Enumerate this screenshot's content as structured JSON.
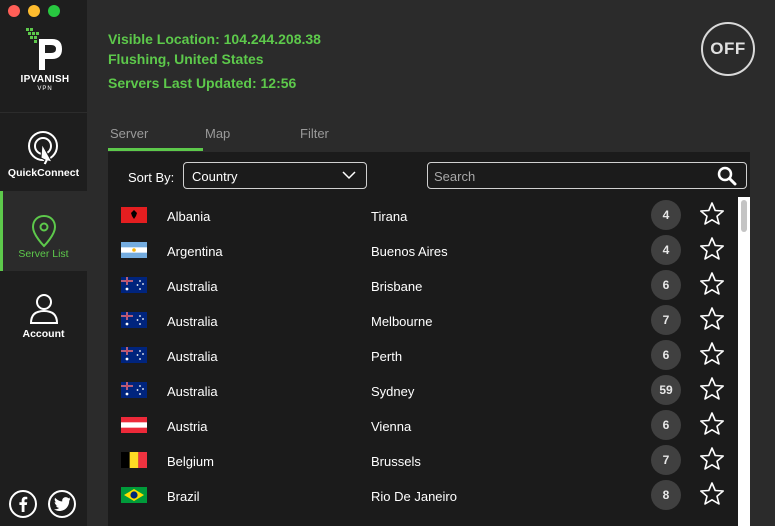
{
  "window": {
    "traffic_lights": {
      "close": "#ff5f57",
      "minimize": "#febc2e",
      "maximize": "#28c840"
    }
  },
  "brand": {
    "name": "IPVANISH",
    "sub": "VPN",
    "accent": "#5dc94b"
  },
  "sidebar": {
    "items": [
      {
        "label": "QuickConnect",
        "icon": "quickconnect-icon"
      },
      {
        "label": "Server List",
        "icon": "map-pin-icon"
      },
      {
        "label": "Account",
        "icon": "user-icon"
      }
    ],
    "social": [
      {
        "icon": "facebook-icon"
      },
      {
        "icon": "twitter-icon"
      }
    ]
  },
  "status": {
    "visible_location": "Visible Location: 104.244.208.38",
    "city": "Flushing, United States",
    "servers_updated": "Servers Last Updated: 12:56",
    "toggle_label": "OFF"
  },
  "tabs": [
    {
      "label": "Server"
    },
    {
      "label": "Map"
    },
    {
      "label": "Filter"
    }
  ],
  "controls": {
    "sort_label": "Sort By:",
    "sort_value": "Country",
    "search_placeholder": "Search"
  },
  "servers": [
    {
      "flag": "albania",
      "country": "Albania",
      "city": "Tirana",
      "count": "4"
    },
    {
      "flag": "argentina",
      "country": "Argentina",
      "city": "Buenos Aires",
      "count": "4"
    },
    {
      "flag": "australia",
      "country": "Australia",
      "city": "Brisbane",
      "count": "6"
    },
    {
      "flag": "australia",
      "country": "Australia",
      "city": "Melbourne",
      "count": "7"
    },
    {
      "flag": "australia",
      "country": "Australia",
      "city": "Perth",
      "count": "6"
    },
    {
      "flag": "australia",
      "country": "Australia",
      "city": "Sydney",
      "count": "59"
    },
    {
      "flag": "austria",
      "country": "Austria",
      "city": "Vienna",
      "count": "6"
    },
    {
      "flag": "belgium",
      "country": "Belgium",
      "city": "Brussels",
      "count": "7"
    },
    {
      "flag": "brazil",
      "country": "Brazil",
      "city": "Rio De Janeiro",
      "count": "8"
    }
  ]
}
